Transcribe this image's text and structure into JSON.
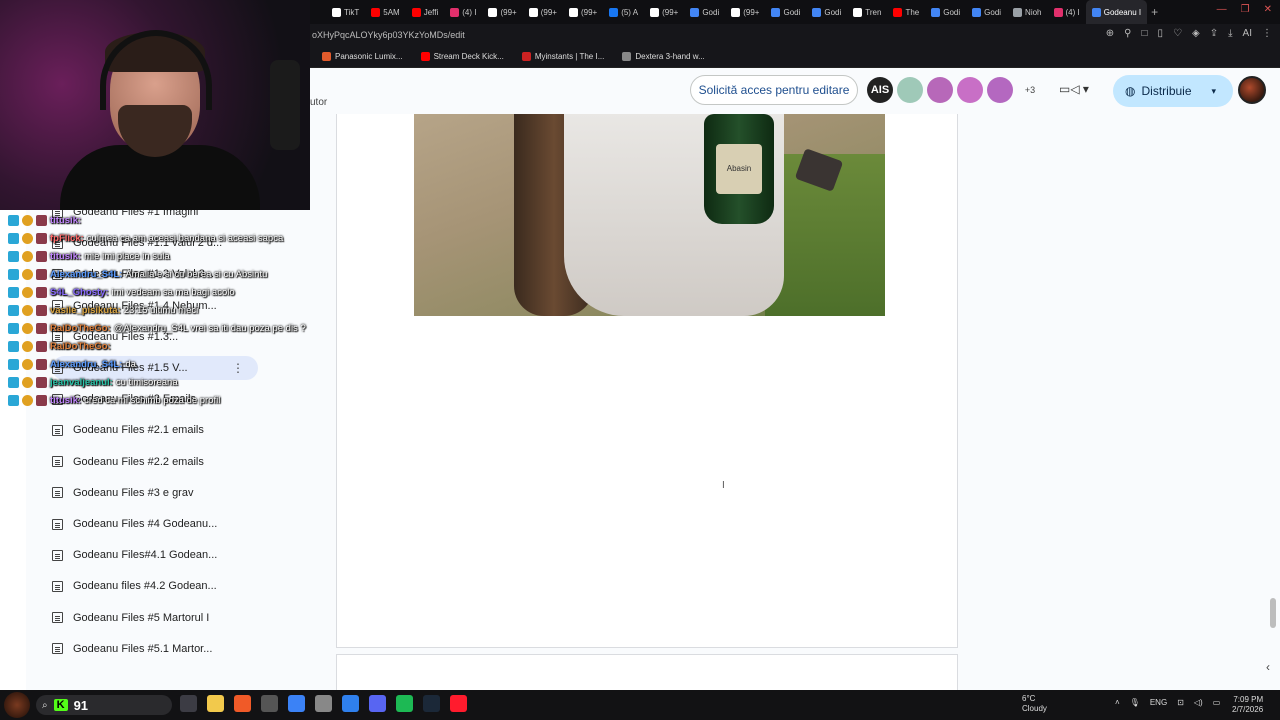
{
  "browser": {
    "tabs": [
      {
        "label": "TikT",
        "color": "#ffffff"
      },
      {
        "label": "5AM",
        "color": "#ff0000"
      },
      {
        "label": "Jeffi",
        "color": "#ff0000"
      },
      {
        "label": "(4) I",
        "color": "#e1306c"
      },
      {
        "label": "(99+",
        "color": "#ffffff"
      },
      {
        "label": "(99+",
        "color": "#ffffff"
      },
      {
        "label": "(99+",
        "color": "#ffffff"
      },
      {
        "label": "(5) A",
        "color": "#1877f2"
      },
      {
        "label": "(99+",
        "color": "#ffffff"
      },
      {
        "label": "Godi",
        "color": "#4285f4"
      },
      {
        "label": "(99+",
        "color": "#ffffff"
      },
      {
        "label": "Godi",
        "color": "#4285f4"
      },
      {
        "label": "Godi",
        "color": "#4285f4"
      },
      {
        "label": "Tren",
        "color": "#ffffff"
      },
      {
        "label": "The",
        "color": "#ff0000"
      },
      {
        "label": "Godi",
        "color": "#4285f4"
      },
      {
        "label": "Godi",
        "color": "#4285f4"
      },
      {
        "label": "Nioh",
        "color": "#9aa0a6"
      },
      {
        "label": "(4) I",
        "color": "#e1306c"
      },
      {
        "label": "Godeanu I",
        "color": "#4285f4",
        "active": true
      }
    ],
    "new_tab": "+",
    "url": "oXHyPqcALOYky6p03YKzYoMDs/edit",
    "bookmarks": [
      {
        "label": "Panasonic Lumix...",
        "color": "#e25b2c"
      },
      {
        "label": "Stream Deck Kick...",
        "color": "#ff0000"
      },
      {
        "label": "Myinstants | The I...",
        "color": "#cc2222"
      },
      {
        "label": "Dextera 3-hand w...",
        "color": "#888888"
      }
    ]
  },
  "doc_header": {
    "left_label": "utor",
    "request_edit": "Solicită acces pentru editare",
    "avatars": [
      {
        "label": "AIS",
        "color": "#222222"
      },
      {
        "label": "",
        "color": "#9fc9b8"
      },
      {
        "label": "",
        "color": "#b768b9"
      },
      {
        "label": "",
        "color": "#c86fc6"
      },
      {
        "label": "",
        "color": "#b468c0"
      }
    ],
    "more_count": "+3",
    "share_label": "Distribuie"
  },
  "photo": {
    "bottle_label": "Abasin"
  },
  "outline": [
    {
      "label": "Godeanu Files #1 Imagini"
    },
    {
      "label": "Godeanu Files #1.1 valul 2 d..."
    },
    {
      "label": "Godeanu Files #1.2 Valul 3 ..."
    },
    {
      "label": "Godeanu Files #1.4 Nehum..."
    },
    {
      "label": "Godeanu Files #1.3..."
    },
    {
      "label": "Godeanu Files #1.5 V...",
      "selected": true
    },
    {
      "label": "Godeanu Files #2 Emails"
    },
    {
      "label": "Godeanu Files #2.1 emails"
    },
    {
      "label": "Godeanu Files #2.2 emails"
    },
    {
      "label": "Godeanu Files #3 e grav"
    },
    {
      "label": "Godeanu Files #4 Godeanu..."
    },
    {
      "label": "Godeanu Files#4.1 Godean..."
    },
    {
      "label": "Godeanu files #4.2 Godean..."
    },
    {
      "label": "Godeanu Files #5 Martorul I"
    },
    {
      "label": "Godeanu Files #5.1 Martor..."
    }
  ],
  "chat": [
    {
      "user": "titusik:",
      "text": "",
      "color": "#c084fc"
    },
    {
      "user": "fpFlick:",
      "text": "culmea ca am aceasi bandana si aceasi sapca",
      "color": "#ff6b6b"
    },
    {
      "user": "titusik:",
      "text": "mie imi place in sula",
      "color": "#c084fc"
    },
    {
      "user": "Alexandru_S4L:",
      "text": "Amalia e si cu berea si cu Absintu",
      "color": "#5b9cff"
    },
    {
      "user": "S4L_Ghosty:",
      "text": "imi vedeam sa ma bagi acolo",
      "color": "#8a6cff"
    },
    {
      "user": "vasile_pisikuta:",
      "text": "23:15 ultimu meci",
      "color": "#d9a441"
    },
    {
      "user": "RaiDoTheGo:",
      "text": "@Alexandru_S4L vrei sa iti dau poza pe dis ?",
      "color": "#e0803c"
    },
    {
      "user": "RaiDoTheGo:",
      "text": "",
      "color": "#e0803c"
    },
    {
      "user": "Alexandru_S4L:",
      "text": "da",
      "color": "#5b9cff"
    },
    {
      "user": "jeanvaljeanul:",
      "text": "cu timisoreana",
      "color": "#29c4a9"
    },
    {
      "user": "titusik:",
      "text": "cred ca mi schimb poza de profil",
      "color": "#c084fc"
    }
  ],
  "taskbar": {
    "search_value": "91",
    "kick_label": "K",
    "weather_temp": "6°C",
    "weather_desc": "Cloudy",
    "language": "ENG",
    "time": "7:09 PM",
    "date": "2/7/2026",
    "apps": [
      {
        "name": "task-view",
        "color": "#3c3c44"
      },
      {
        "name": "file-explorer",
        "color": "#f2c94c"
      },
      {
        "name": "brave",
        "color": "#f05a28"
      },
      {
        "name": "obs",
        "color": "#555555"
      },
      {
        "name": "store",
        "color": "#3b82f6"
      },
      {
        "name": "chatgpt",
        "color": "#888888"
      },
      {
        "name": "streamlabs",
        "color": "#2f80ed"
      },
      {
        "name": "discord",
        "color": "#5865f2"
      },
      {
        "name": "spotify",
        "color": "#1db954"
      },
      {
        "name": "steam",
        "color": "#1b2838"
      },
      {
        "name": "opera",
        "color": "#ff1b2d"
      }
    ]
  }
}
